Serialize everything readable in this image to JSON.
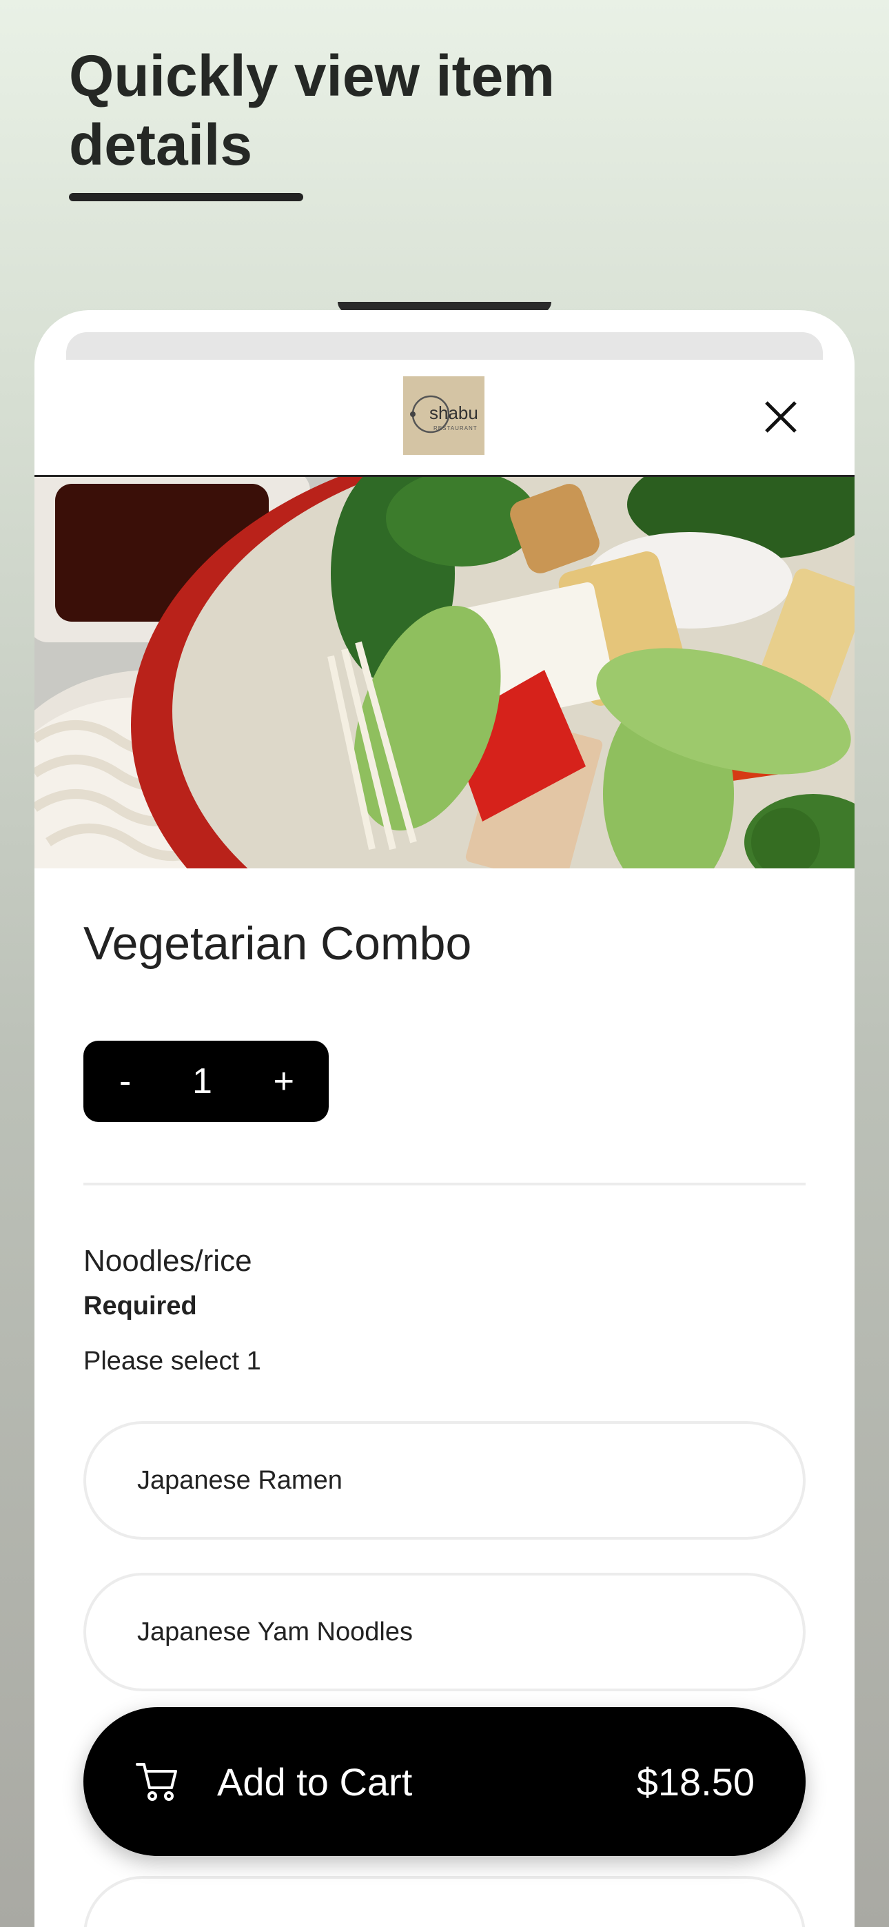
{
  "promo": {
    "headline": "Quickly view item details"
  },
  "modal": {
    "logo_text": "shabu",
    "logo_subtext": "RESTAURANT",
    "close_icon": "close-icon"
  },
  "item": {
    "name": "Vegetarian Combo",
    "quantity": "1",
    "decrement_label": "-",
    "increment_label": "+"
  },
  "option_group": {
    "title": "Noodles/rice",
    "required_label": "Required",
    "hint": "Please select 1",
    "options": [
      "Japanese Ramen",
      "Japanese Yam Noodles"
    ]
  },
  "cart": {
    "label": "Add to Cart",
    "price": "$18.50",
    "icon": "cart-icon"
  }
}
